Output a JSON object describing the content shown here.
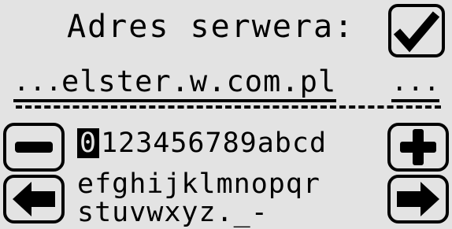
{
  "screen": {
    "title": "Adres serwera:",
    "address_prefix_ellipsis": "...",
    "address": "elster.w.com.pl",
    "address_suffix_ellipsis": "...",
    "confirm_button": {
      "icon": "checkmark-icon"
    },
    "buttons": {
      "decrease": "minus-icon",
      "increase": "plus-icon",
      "cursor_left": "arrow-left-icon",
      "cursor_right": "arrow-right-icon"
    }
  },
  "keyboard": {
    "selected_char": "0",
    "row1_rest": "123456789abcd",
    "row2": "efghijklmnopqr",
    "row3": "stuvwxyz._-"
  },
  "colors": {
    "background": "#e3e3e3",
    "foreground": "#000000"
  }
}
